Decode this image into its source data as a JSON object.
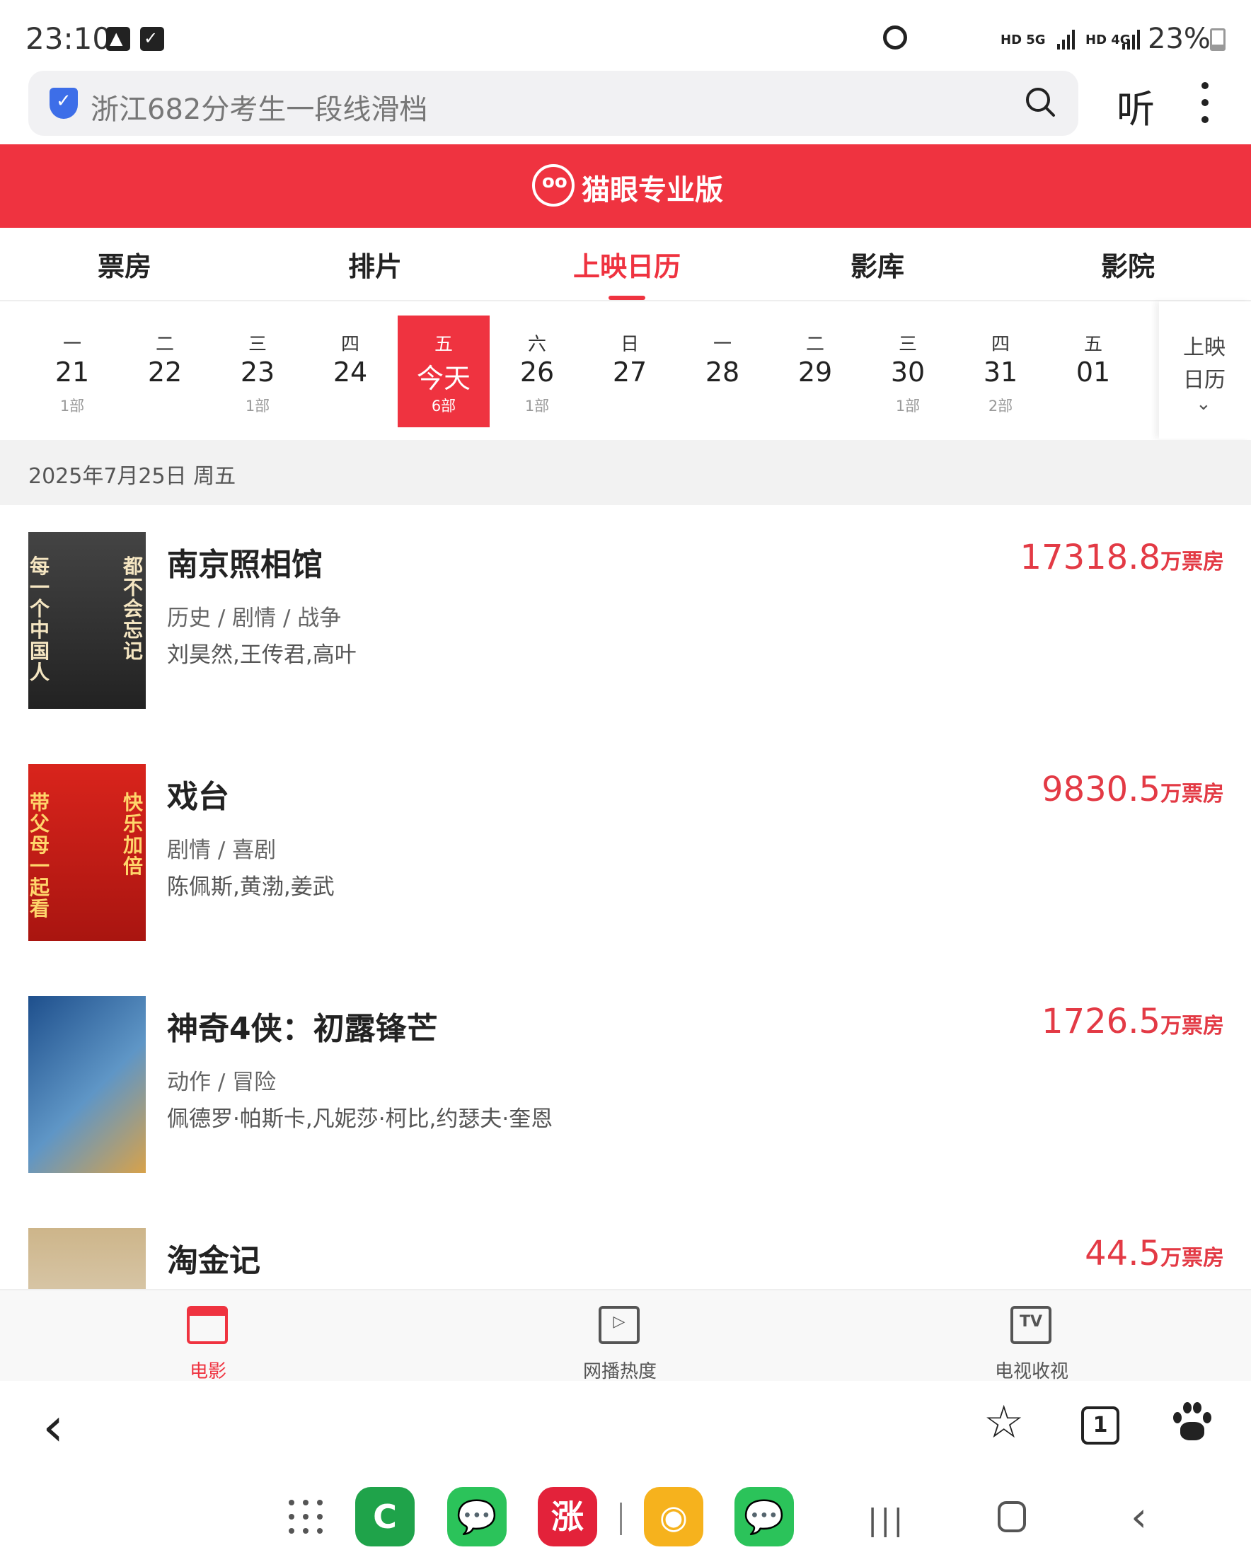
{
  "status_bar": {
    "time": "23:10",
    "net1": "HD 5G",
    "net2": "HD 4G",
    "battery": "23%",
    "battery_level": 0.23
  },
  "browser": {
    "search_query": "浙江682分考生一段线滑档",
    "listen_label": "听"
  },
  "app": {
    "brand": "猫眼专业版",
    "accent_color": "#ef3340"
  },
  "tabs": [
    {
      "label": "票房"
    },
    {
      "label": "排片"
    },
    {
      "label": "上映日历"
    },
    {
      "label": "影库"
    },
    {
      "label": "影院"
    }
  ],
  "calendar": {
    "days": [
      {
        "weekday": "一",
        "date": "21",
        "count": "1部"
      },
      {
        "weekday": "二",
        "date": "22",
        "count": ""
      },
      {
        "weekday": "三",
        "date": "23",
        "count": "1部"
      },
      {
        "weekday": "四",
        "date": "24",
        "count": ""
      },
      {
        "weekday": "五",
        "date": "今天",
        "count": "6部"
      },
      {
        "weekday": "六",
        "date": "26",
        "count": "1部"
      },
      {
        "weekday": "日",
        "date": "27",
        "count": ""
      },
      {
        "weekday": "一",
        "date": "28",
        "count": ""
      },
      {
        "weekday": "二",
        "date": "29",
        "count": ""
      },
      {
        "weekday": "三",
        "date": "30",
        "count": "1部"
      },
      {
        "weekday": "四",
        "date": "31",
        "count": "2部"
      },
      {
        "weekday": "五",
        "date": "01",
        "count": ""
      }
    ],
    "side_line1": "上映",
    "side_line2": "日历"
  },
  "date_header": "2025年7月25日 周五",
  "movies": [
    {
      "title": "南京照相馆",
      "genre": "历史 / 剧情 / 战争",
      "cast": "刘昊然,王传君,高叶",
      "box": "17318.8",
      "unit": "万票房",
      "poster_left": "每一个中国人",
      "poster_right": "都不会忘记"
    },
    {
      "title": "戏台",
      "genre": "剧情 / 喜剧",
      "cast": "陈佩斯,黄渤,姜武",
      "box": "9830.5",
      "unit": "万票房",
      "poster_left": "带父母一起看",
      "poster_right": "快乐加倍"
    },
    {
      "title": "神奇4侠：初露锋芒",
      "genre": "动作 / 冒险",
      "cast": "佩德罗·帕斯卡,凡妮莎·柯比,约瑟夫·奎恩",
      "box": "1726.5",
      "unit": "万票房",
      "poster_left": "",
      "poster_right": ""
    },
    {
      "title": "淘金记",
      "genre": "",
      "cast": "",
      "box": "44.5",
      "unit": "万票房",
      "poster_left": "",
      "poster_right": ""
    }
  ],
  "bottom_tabs": [
    {
      "label": "电影"
    },
    {
      "label": "网播热度"
    },
    {
      "label": "电视收视",
      "icon_text": "TV"
    }
  ],
  "browser_nav": {
    "tab_count": "1"
  },
  "dock": {
    "apps": [
      {
        "name": "C",
        "color": "#1fa34a"
      },
      {
        "name": "",
        "color": "#2bc35a"
      },
      {
        "name": "涨",
        "color": "#e3223a"
      },
      {
        "name": "",
        "color": "#f6b21d"
      },
      {
        "name": "",
        "color": "#2bc35a"
      }
    ]
  }
}
